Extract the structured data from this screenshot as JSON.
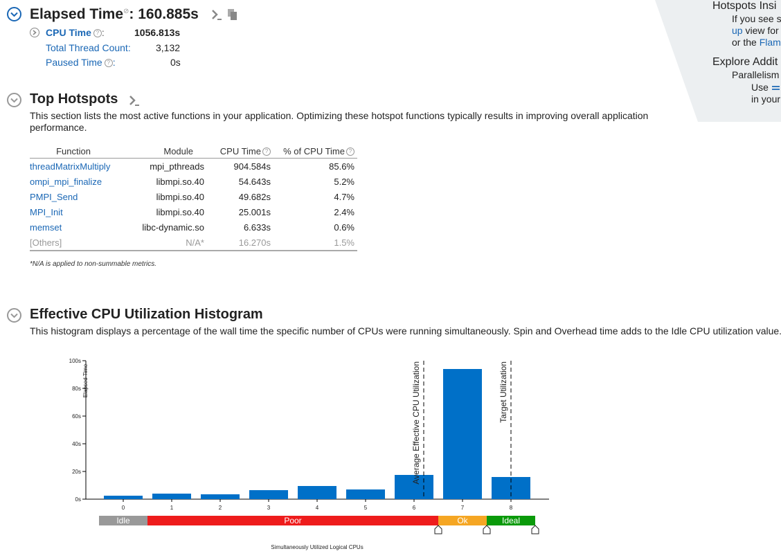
{
  "elapsed": {
    "label": "Elapsed Time",
    "help": "?",
    "separator": ":",
    "value": "160.885s"
  },
  "metrics": {
    "cpu_time": {
      "label": "CPU Time",
      "value": "1056.813s"
    },
    "thread_count": {
      "label": "Total Thread Count:",
      "value": "3,132"
    },
    "paused_time": {
      "label": "Paused Time",
      "value": "0s"
    }
  },
  "hotspots": {
    "title": "Top Hotspots",
    "description_line1": "This section lists the most active functions in your application. Optimizing these hotspot functions typically results in improving overall application",
    "description_line2": "performance.",
    "columns": [
      "Function",
      "Module",
      "CPU Time",
      "% of CPU Time"
    ],
    "rows": [
      {
        "function": "threadMatrixMultiply",
        "module": "mpi_pthreads",
        "cpu_time": "904.584s",
        "percent": "85.6%"
      },
      {
        "function": "ompi_mpi_finalize",
        "module": "libmpi.so.40",
        "cpu_time": "54.643s",
        "percent": "5.2%"
      },
      {
        "function": "PMPI_Send",
        "module": "libmpi.so.40",
        "cpu_time": "49.682s",
        "percent": "4.7%"
      },
      {
        "function": "MPI_Init",
        "module": "libmpi.so.40",
        "cpu_time": "25.001s",
        "percent": "2.4%"
      },
      {
        "function": "memset",
        "module": "libc-dynamic.so",
        "cpu_time": "6.633s",
        "percent": "0.6%"
      },
      {
        "function": "[Others]",
        "module": "N/A*",
        "cpu_time": "16.270s",
        "percent": "1.5%"
      }
    ],
    "footnote": "*N/A is applied to non-summable metrics."
  },
  "histogram": {
    "title": "Effective CPU Utilization Histogram",
    "description": "This histogram displays a percentage of the wall time the specific number of CPUs were running simultaneously. Spin and Overhead time adds to the Idle CPU utilization value."
  },
  "insights": {
    "heading1": "Hotspots Insi",
    "line1": "If you see s",
    "line2_link": "up",
    "line2_rest": " view for",
    "line3_pre": "or the ",
    "line3_link": "Flam",
    "heading2": "Explore Addit",
    "line4": "Parallelism",
    "line5": "Use",
    "line6": "in your"
  },
  "colors": {
    "link": "#1a67b5",
    "bar": "#0070c8",
    "idle": "#999999",
    "poor": "#ee1c1c",
    "ok": "#f5a623",
    "ideal": "#0a9a0a"
  },
  "chart_data": {
    "type": "bar",
    "categories": [
      "0",
      "1",
      "2",
      "3",
      "4",
      "5",
      "6",
      "7",
      "8"
    ],
    "values": [
      2.5,
      4,
      3.5,
      6.5,
      9.5,
      7,
      17.5,
      94,
      16
    ],
    "ylabel": "Elapsed Time",
    "xlabel": "Simultaneously Utilized Logical CPUs",
    "ylim": [
      0,
      100
    ],
    "yticks": [
      "0s",
      "20s",
      "40s",
      "60s",
      "80s",
      "100s"
    ],
    "markers": [
      {
        "label": "Average Effective CPU Utilization",
        "x": 6.2
      },
      {
        "label": "Target Utilization",
        "x": 8
      }
    ],
    "ranges": [
      {
        "label": "Idle",
        "from": -0.5,
        "to": 0.5
      },
      {
        "label": "Poor",
        "from": 0.5,
        "to": 6.5
      },
      {
        "label": "Ok",
        "from": 6.5,
        "to": 7.5
      },
      {
        "label": "Ideal",
        "from": 7.5,
        "to": 8.5
      }
    ]
  }
}
